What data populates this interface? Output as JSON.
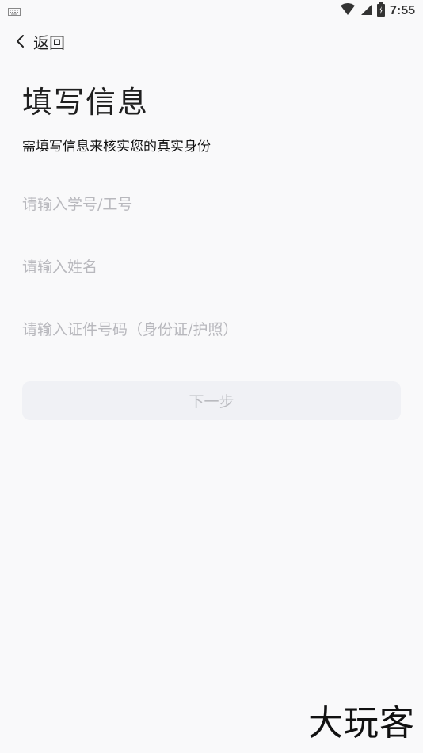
{
  "status_bar": {
    "time": "7:55",
    "icons": [
      "keyboard-icon",
      "wifi-icon",
      "signal-icon",
      "battery-charging-icon"
    ]
  },
  "nav": {
    "back_label": "返回",
    "back_icon": "chevron-left-icon"
  },
  "page": {
    "title": "填写信息",
    "subtitle": "需填写信息来核实您的真实身份"
  },
  "form": {
    "id_number": {
      "placeholder": "请输入学号/工号",
      "value": ""
    },
    "name": {
      "placeholder": "请输入姓名",
      "value": ""
    },
    "id_card": {
      "placeholder": "请输入证件号码（身份证/护照）",
      "value": ""
    },
    "next_label": "下一步"
  },
  "watermark": {
    "text": "大玩客"
  },
  "colors": {
    "background": "#f9f9fa",
    "button_bg": "#f0f1f5",
    "button_text": "#b9babf",
    "placeholder": "#b8b8bd"
  }
}
